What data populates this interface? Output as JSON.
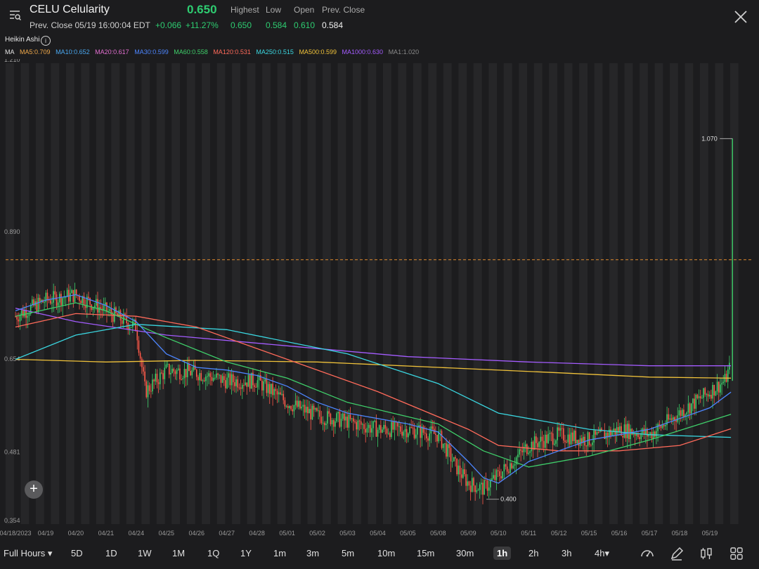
{
  "header": {
    "symbol_name": "CELU Celularity",
    "prev_close_time": "Prev. Close 05/19 16:00:04 EDT",
    "price": "0.650",
    "change": "+0.066",
    "change_pct": "+11.27%",
    "stats": [
      {
        "label": "Highest",
        "value": "0.650"
      },
      {
        "label": "Low",
        "value": "0.584"
      },
      {
        "label": "Open",
        "value": "0.610"
      },
      {
        "label": "Prev. Close",
        "value": "0.584"
      }
    ]
  },
  "indicator": {
    "name": "Heikin Ashi",
    "info_glyph": "i"
  },
  "ma_legend": [
    {
      "text": "MA",
      "color": "#e6e6e6"
    },
    {
      "text": "MA5:0.709",
      "color": "#f0a94a"
    },
    {
      "text": "MA10:0.652",
      "color": "#4aa8f0"
    },
    {
      "text": "MA20:0.617",
      "color": "#e36fd1"
    },
    {
      "text": "MA30:0.599",
      "color": "#4d86ff"
    },
    {
      "text": "MA60:0.558",
      "color": "#3fcf6a"
    },
    {
      "text": "MA120:0.531",
      "color": "#ff6a5a"
    },
    {
      "text": "MA250:0.515",
      "color": "#3ad6e0"
    },
    {
      "text": "MA500:0.599",
      "color": "#f0c23a"
    },
    {
      "text": "MA1000:0.630",
      "color": "#a45cff"
    },
    {
      "text": "MA1:1.020",
      "color": "#8a8a8a"
    }
  ],
  "chart_data": {
    "type": "line",
    "candle_style": "heikin-ashi",
    "ylim": [
      0.354,
      1.21
    ],
    "y_ticks": [
      "1.210",
      "0.890",
      "0.654",
      "0.481",
      "0.354"
    ],
    "x_ticks": [
      "04/18/2023",
      "04/19",
      "04/20",
      "04/21",
      "04/24",
      "04/25",
      "04/26",
      "04/27",
      "04/28",
      "05/01",
      "05/02",
      "05/03",
      "05/04",
      "05/05",
      "05/08",
      "05/09",
      "05/10",
      "05/11",
      "05/12",
      "05/15",
      "05/16",
      "05/17",
      "05/18",
      "05/19"
    ],
    "annotations": [
      {
        "label": "1.070",
        "value": 1.07
      },
      {
        "label": "0.400",
        "value": 0.4
      }
    ],
    "prev_close_line": 0.845,
    "series": [
      {
        "name": "MA1000",
        "color": "#a45cff",
        "x": [
          0,
          2,
          5,
          9,
          13,
          17,
          21,
          23.7
        ],
        "values": [
          0.755,
          0.73,
          0.705,
          0.685,
          0.665,
          0.655,
          0.648,
          0.648
        ]
      },
      {
        "name": "MA500",
        "color": "#f0c23a",
        "x": [
          0,
          3,
          6,
          10,
          14,
          18,
          21,
          23.7
        ],
        "values": [
          0.66,
          0.655,
          0.658,
          0.655,
          0.645,
          0.635,
          0.627,
          0.625
        ]
      },
      {
        "name": "MA250",
        "color": "#3ad6e0",
        "x": [
          0,
          2,
          4,
          7,
          11,
          14,
          16,
          19,
          21,
          23.7
        ],
        "values": [
          0.66,
          0.705,
          0.725,
          0.715,
          0.67,
          0.615,
          0.56,
          0.53,
          0.52,
          0.515
        ]
      },
      {
        "name": "MA120",
        "color": "#ff6a5a",
        "x": [
          0,
          2,
          4,
          6,
          9,
          12,
          15,
          16,
          18,
          20,
          22,
          23.7
        ],
        "values": [
          0.72,
          0.745,
          0.74,
          0.72,
          0.66,
          0.6,
          0.53,
          0.5,
          0.49,
          0.49,
          0.5,
          0.531
        ]
      },
      {
        "name": "MA60",
        "color": "#3fcf6a",
        "x": [
          0,
          2,
          3,
          5,
          7,
          9,
          11,
          14,
          15.5,
          17,
          19,
          21,
          23.7
        ],
        "values": [
          0.74,
          0.765,
          0.75,
          0.7,
          0.655,
          0.625,
          0.58,
          0.54,
          0.49,
          0.46,
          0.48,
          0.51,
          0.558
        ]
      },
      {
        "name": "MA30",
        "color": "#4d86ff",
        "x": [
          0,
          1,
          2,
          3,
          4,
          5,
          6,
          7,
          8,
          9,
          10,
          11,
          12,
          13,
          14,
          15,
          15.5,
          16,
          17,
          18,
          19,
          20,
          21,
          22,
          23,
          23.7
        ],
        "values": [
          0.75,
          0.77,
          0.78,
          0.76,
          0.73,
          0.67,
          0.645,
          0.64,
          0.63,
          0.61,
          0.58,
          0.56,
          0.55,
          0.54,
          0.525,
          0.47,
          0.44,
          0.43,
          0.47,
          0.49,
          0.51,
          0.52,
          0.53,
          0.55,
          0.57,
          0.599
        ]
      }
    ]
  },
  "toolbar": {
    "session": "Full Hours",
    "periods": [
      "5D",
      "1D",
      "1W",
      "1M",
      "1Q",
      "1Y",
      "1m",
      "3m",
      "5m",
      "10m",
      "15m",
      "30m",
      "1h",
      "2h",
      "3h",
      "4h"
    ],
    "selected": "1h"
  }
}
